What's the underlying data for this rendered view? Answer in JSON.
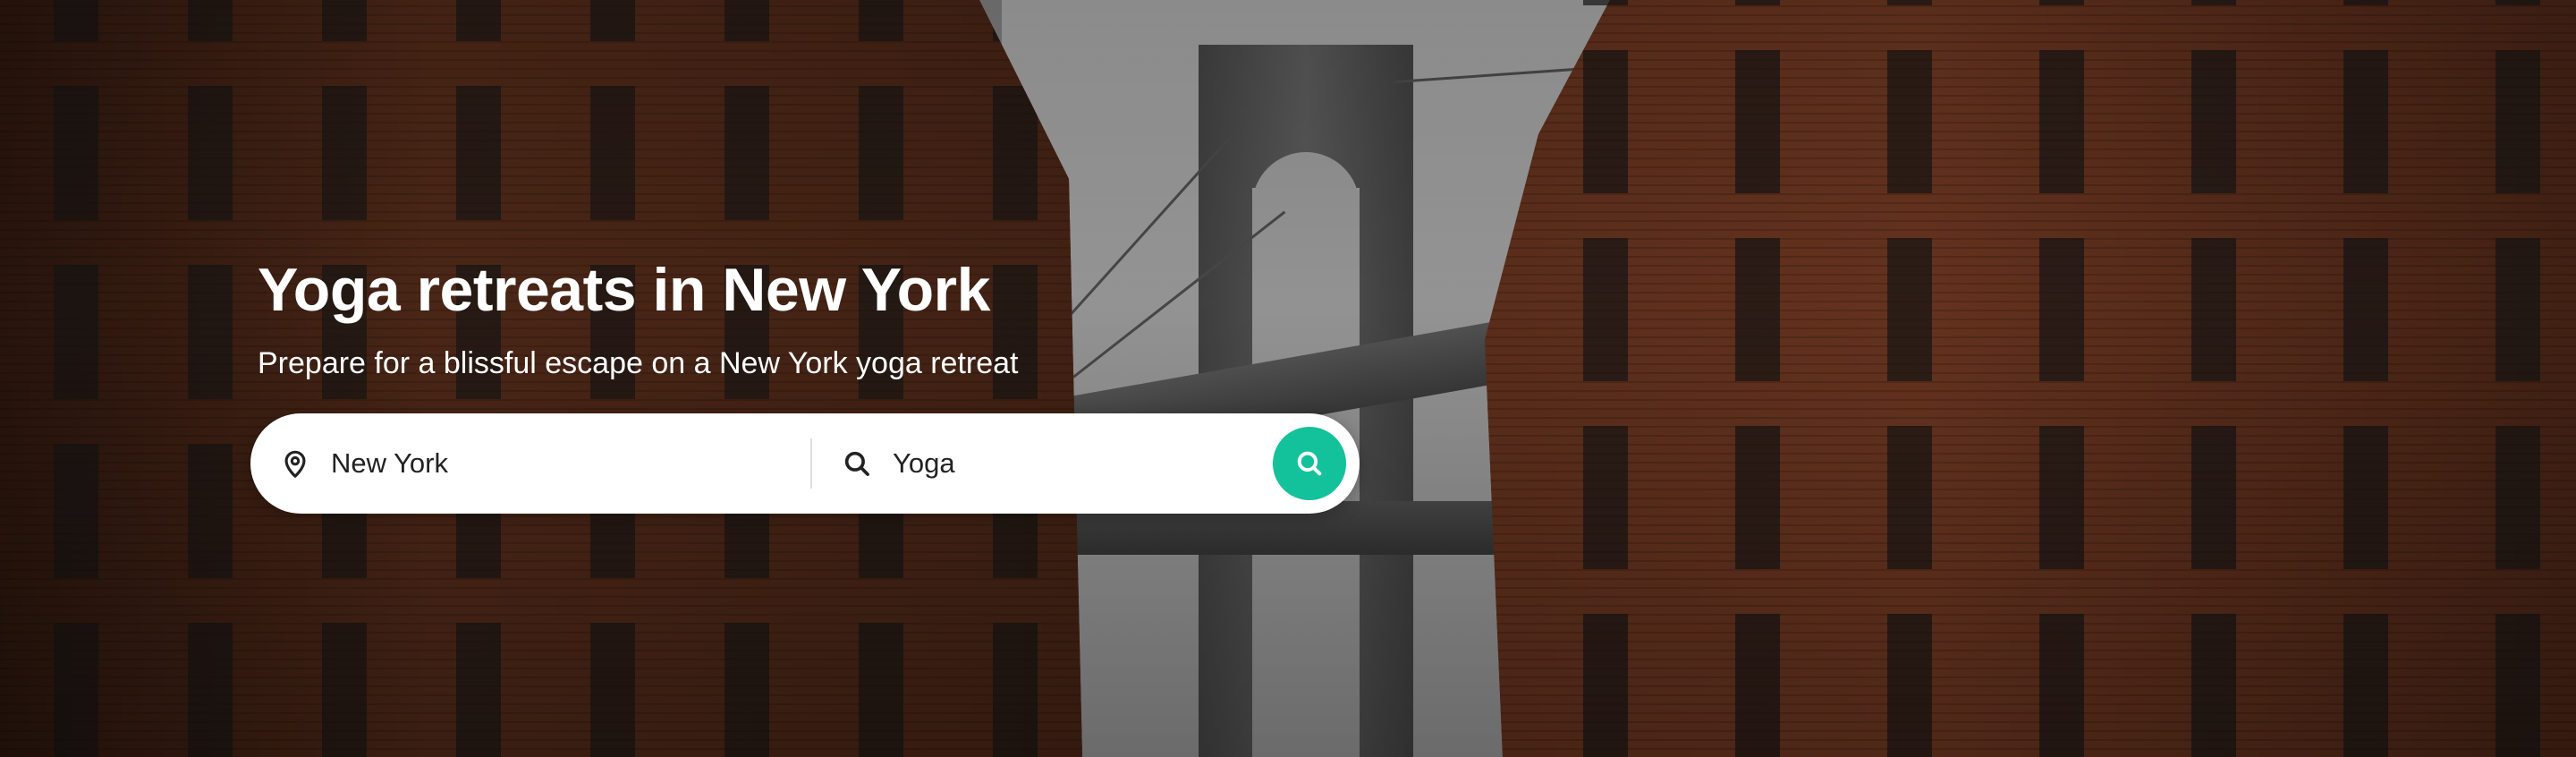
{
  "hero": {
    "title": "Yoga retreats in New York",
    "subtitle": "Prepare for a blissful escape on a New York yoga retreat"
  },
  "search": {
    "location_value": "New York",
    "location_icon": "map-pin-icon",
    "activity_value": "Yoga",
    "activity_icon": "search-icon",
    "submit_icon": "search-icon"
  },
  "colors": {
    "accent": "#13c29a",
    "text_light": "#ffffff",
    "text_dark": "#222222",
    "search_bg": "#ffffff"
  }
}
